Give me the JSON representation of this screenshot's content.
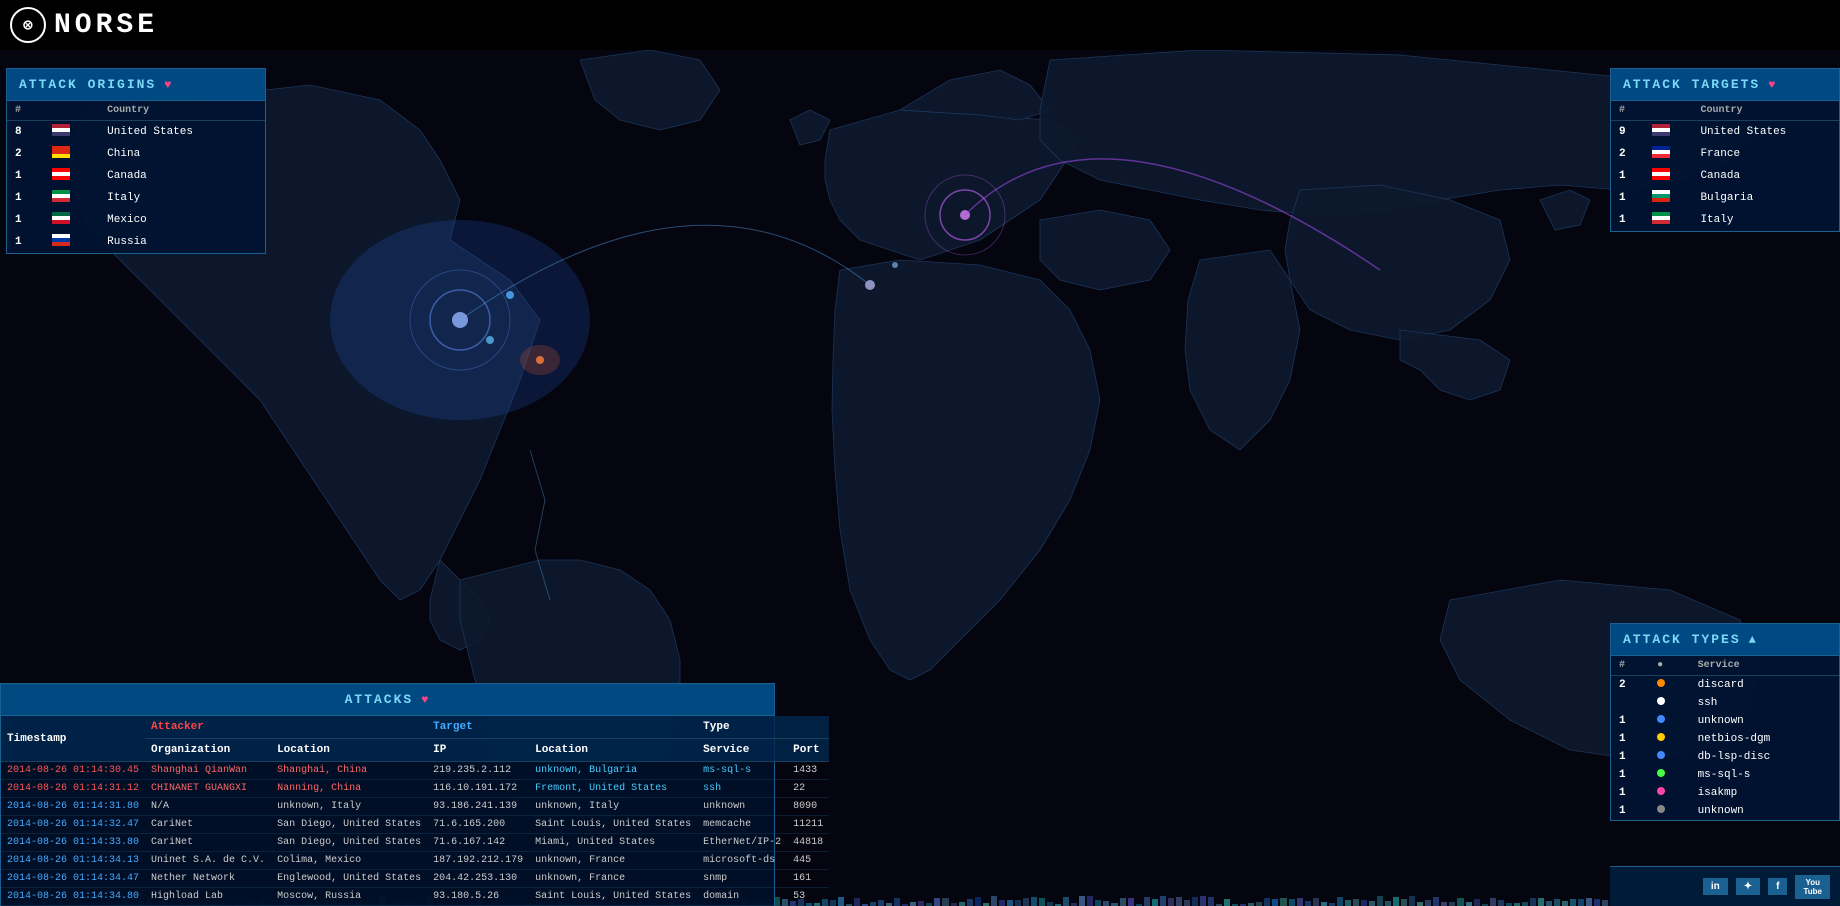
{
  "app": {
    "logo_symbol": "⊗",
    "logo_text": "NORSE"
  },
  "attack_origins": {
    "title": "ATTACK ORIGINS",
    "icon": "♥",
    "columns": [
      "#",
      "",
      "Country"
    ],
    "rows": [
      {
        "count": "8",
        "flag": "us",
        "country": "United States"
      },
      {
        "count": "2",
        "flag": "cn",
        "country": "China"
      },
      {
        "count": "1",
        "flag": "ca",
        "country": "Canada"
      },
      {
        "count": "1",
        "flag": "it",
        "country": "Italy"
      },
      {
        "count": "1",
        "flag": "mx",
        "country": "Mexico"
      },
      {
        "count": "1",
        "flag": "ru",
        "country": "Russia"
      }
    ]
  },
  "attack_targets": {
    "title": "ATTACK TARGETS",
    "icon": "♥",
    "columns": [
      "#",
      "",
      "Country"
    ],
    "rows": [
      {
        "count": "9",
        "flag": "us",
        "country": "United States"
      },
      {
        "count": "2",
        "flag": "fr",
        "country": "France"
      },
      {
        "count": "1",
        "flag": "ca",
        "country": "Canada"
      },
      {
        "count": "1",
        "flag": "bg",
        "country": "Bulgaria"
      },
      {
        "count": "1",
        "flag": "it",
        "country": "Italy"
      }
    ]
  },
  "attack_types": {
    "title": "ATTACK TYPES",
    "icon": "▲",
    "col_count": "#",
    "col_dot": "●",
    "col_service": "Service",
    "rows": [
      {
        "count": "2",
        "dot_color": "orange",
        "service": "discard"
      },
      {
        "count": "",
        "dot_color": "white",
        "service": "ssh"
      },
      {
        "count": "1",
        "dot_color": "blue",
        "service": "unknown"
      },
      {
        "count": "1",
        "dot_color": "yellow",
        "service": "netbios-dgm"
      },
      {
        "count": "1",
        "dot_color": "blue",
        "service": "db-lsp-disc"
      },
      {
        "count": "1",
        "dot_color": "green",
        "service": "ms-sql-s"
      },
      {
        "count": "1",
        "dot_color": "pink",
        "service": "isakmp"
      },
      {
        "count": "1",
        "dot_color": "gray",
        "service": "unknown"
      }
    ]
  },
  "attacks_panel": {
    "title": "ATTACKS",
    "icon": "♥",
    "columns": {
      "timestamp": "Timestamp",
      "organization": "Organization",
      "attacker_location": "Location",
      "ip": "IP",
      "target_location": "Location",
      "service": "Service",
      "type": "Type",
      "port": "Port"
    },
    "rows": [
      {
        "timestamp": "2014-08-26 01:14:30.45",
        "organization": "Shanghai QianWan",
        "attacker_location": "Shanghai, China",
        "ip": "219.235.2.112",
        "target_location": "unknown, Bulgaria",
        "service": "ms-sql-s",
        "type": "",
        "port": "1433",
        "highlight": "red"
      },
      {
        "timestamp": "2014-08-26 01:14:31.12",
        "organization": "CHINANET GUANGXI",
        "attacker_location": "Nanning, China",
        "ip": "116.10.191.172",
        "target_location": "Fremont, United States",
        "service": "ssh",
        "type": "",
        "port": "22",
        "highlight": "red"
      },
      {
        "timestamp": "2014-08-26 01:14:31.80",
        "organization": "N/A",
        "attacker_location": "unknown, Italy",
        "ip": "93.186.241.139",
        "target_location": "unknown, Italy",
        "service": "unknown",
        "type": "",
        "port": "8090",
        "highlight": ""
      },
      {
        "timestamp": "2014-08-26 01:14:32.47",
        "organization": "CariNet",
        "attacker_location": "San Diego, United States",
        "ip": "71.6.165.200",
        "target_location": "Saint Louis, United States",
        "service": "memcache",
        "type": "",
        "port": "11211",
        "highlight": ""
      },
      {
        "timestamp": "2014-08-26 01:14:33.80",
        "organization": "CariNet",
        "attacker_location": "San Diego, United States",
        "ip": "71.6.167.142",
        "target_location": "Miami, United States",
        "service": "EtherNet/IP-2",
        "type": "",
        "port": "44818",
        "highlight": ""
      },
      {
        "timestamp": "2014-08-26 01:14:34.13",
        "organization": "Uninet S.A. de C.V.",
        "attacker_location": "Colima, Mexico",
        "ip": "187.192.212.179",
        "target_location": "unknown, France",
        "service": "microsoft-ds",
        "type": "",
        "port": "445",
        "highlight": ""
      },
      {
        "timestamp": "2014-08-26 01:14:34.47",
        "organization": "Nether Network",
        "attacker_location": "Englewood, United States",
        "ip": "204.42.253.130",
        "target_location": "unknown, France",
        "service": "snmp",
        "type": "",
        "port": "161",
        "highlight": ""
      },
      {
        "timestamp": "2014-08-26 01:14:34.80",
        "organization": "Highload Lab",
        "attacker_location": "Moscow, Russia",
        "ip": "93.180.5.26",
        "target_location": "Saint Louis, United States",
        "service": "domain",
        "type": "",
        "port": "53",
        "highlight": ""
      }
    ]
  },
  "social": {
    "linkedin": "in",
    "twitter": "t",
    "facebook": "f",
    "youtube": "You Tube"
  }
}
